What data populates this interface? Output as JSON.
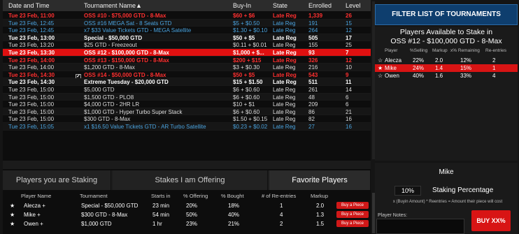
{
  "grid": {
    "headers": [
      "Date and Time",
      "Tournament Name▲",
      "Buy-In",
      "State",
      "Enrolled",
      "Level"
    ],
    "rows": [
      {
        "style": "red",
        "date": "Tue 23 Feb, 11:00",
        "name": "OSS #10 - $75,000 GTD - 8-Max",
        "buyin": "$60 + $6",
        "state": "Late Reg",
        "enrolled": "1,339",
        "level": "26"
      },
      {
        "style": "sat",
        "date": "Tue 23 Feb, 12:45",
        "name": "OSS #16 MEGA Sat - 8 Seats GTD",
        "buyin": "$5 + $0.50",
        "state": "Late Reg",
        "enrolled": "191",
        "level": "15"
      },
      {
        "style": "sat",
        "date": "Tue 23 Feb, 12:45",
        "name": "x7 $33 Value Tickets GTD - MEGA Satellite",
        "buyin": "$1.30 + $0.10",
        "state": "Late Reg",
        "enrolled": "264",
        "level": "12"
      },
      {
        "style": "bold",
        "date": "Tue 23 Feb, 13:00",
        "name": "Special - $50,000 GTD",
        "buyin": "$50 + $5",
        "state": "Late Reg",
        "enrolled": "505",
        "level": "17"
      },
      {
        "style": "norm",
        "date": "Tue 23 Feb, 13:20",
        "name": "$25 GTD - Freezeout",
        "buyin": "$0.11 + $0.01",
        "state": "Late Reg",
        "enrolled": "155",
        "level": "25"
      },
      {
        "style": "sel",
        "date": "Tue 23 Feb, 13:30",
        "name": "OSS #12 - $100,000 GTD - 8-Max",
        "buyin": "$1,000 + $...",
        "state": "Late Reg",
        "enrolled": "93",
        "level": "7"
      },
      {
        "style": "red",
        "date": "Tue 23 Feb, 14:00",
        "name": "OSS #13 - $150,000 GTD - 8-Max",
        "buyin": "$200 + $15",
        "state": "Late Reg",
        "enrolled": "326",
        "level": "12"
      },
      {
        "style": "norm",
        "date": "Tue 23 Feb, 14:00",
        "name": "$1,200 GTD - 8-Max",
        "buyin": "$3 + $0.30",
        "state": "Late Reg",
        "enrolled": "216",
        "level": "10"
      },
      {
        "style": "red",
        "date": "Tue 23 Feb, 14:30",
        "name": "OSS #14 - $50,000 GTD - 8-Max",
        "buyin": "$50 + $5",
        "state": "Late Reg",
        "enrolled": "543",
        "level": "9",
        "check": true
      },
      {
        "style": "bold",
        "date": "Tue 23 Feb, 14:30",
        "name": "Extreme Tuesday - $20,000 GTD",
        "buyin": "$15 + $1.50",
        "state": "Late Reg",
        "enrolled": "511",
        "level": "11"
      },
      {
        "style": "norm",
        "date": "Tue 23 Feb, 15:00",
        "name": "$5,000 GTD",
        "buyin": "$6 + $0.60",
        "state": "Late Reg",
        "enrolled": "261",
        "level": "14"
      },
      {
        "style": "norm",
        "date": "Tue 23 Feb, 15:00",
        "name": "$1,500 GTD - PLO8",
        "buyin": "$6 + $0.60",
        "state": "Late Reg",
        "enrolled": "48",
        "level": "6"
      },
      {
        "style": "norm",
        "date": "Tue 23 Feb, 15:00",
        "name": "$4,000 GTD - 2HR LR",
        "buyin": "$10 + $1",
        "state": "Late Reg",
        "enrolled": "209",
        "level": "6"
      },
      {
        "style": "norm",
        "date": "Tue 23 Feb, 15:00",
        "name": "$1,000 GTD - Hyper Turbo Super Stack",
        "buyin": "$6 + $0.60",
        "state": "Late Reg",
        "enrolled": "86",
        "level": "21"
      },
      {
        "style": "norm",
        "date": "Tue 23 Feb, 15:00",
        "name": "$300 GTD - 8-Max",
        "buyin": "$1.50 + $0.15",
        "state": "Late Reg",
        "enrolled": "82",
        "level": "16"
      },
      {
        "style": "sat",
        "date": "Tue 23 Feb, 15:05",
        "name": "x1 $16.50 Value Tickets GTD - AR Turbo Satellite",
        "buyin": "$0.23 + $0.02",
        "state": "Late Reg",
        "enrolled": "27",
        "level": "16"
      }
    ]
  },
  "tabs": [
    "Players you are Staking",
    "Stakes I am Offering",
    "Favorite Players"
  ],
  "staking": {
    "headers": [
      "Player Name",
      "Tournament",
      "Starts in",
      "% Offering",
      "% Bought",
      "# of Re-entries",
      "Markup"
    ],
    "buy_label": "Buy a Piece",
    "rows": [
      {
        "player": "Alecza  +",
        "tournament": "Special - $50,000 GTD",
        "starts": "23 min",
        "offering": "20%",
        "bought": "18%",
        "reentries": "1",
        "markup": "2.0"
      },
      {
        "player": "Mike  +",
        "tournament": "$300 GTD - 8-Max",
        "starts": "54 min",
        "offering": "50%",
        "bought": "40%",
        "reentries": "4",
        "markup": "1.3"
      },
      {
        "player": "Owen  +",
        "tournament": "$1,000 GTD",
        "starts": "1 hr",
        "offering": "23%",
        "bought": "21%",
        "reentries": "2",
        "markup": "1.5"
      }
    ]
  },
  "right": {
    "filter_label": "FILTER LIST OF TOURNAMENTS",
    "avail_title_1": "Players Available to Stake in",
    "avail_title_2": "OSS #12 - $100,000 GTD - 8-Max",
    "avail_headers": [
      "Player",
      "%Selling",
      "Markup",
      "x% Remaining",
      "Re-entries"
    ],
    "avail_rows": [
      {
        "player": "Alecza",
        "selling": "22%",
        "markup": "2.0",
        "remaining": "12%",
        "reentries": "2",
        "sel": false
      },
      {
        "player": "Mike",
        "selling": "24%",
        "markup": "1.4",
        "remaining": "15%",
        "reentries": "1",
        "sel": true
      },
      {
        "player": "Owen",
        "selling": "40%",
        "markup": "1.6",
        "remaining": "33%",
        "reentries": "4",
        "sel": false
      }
    ],
    "mike_name": "Mike",
    "staking_pct": "10%",
    "staking_label": "Staking Percentage",
    "formula": "x (Buyin Amount) * Reentries = Amount their piece will cost",
    "notes_label": "Player Notes:",
    "buy_label": "BUY XX%"
  }
}
